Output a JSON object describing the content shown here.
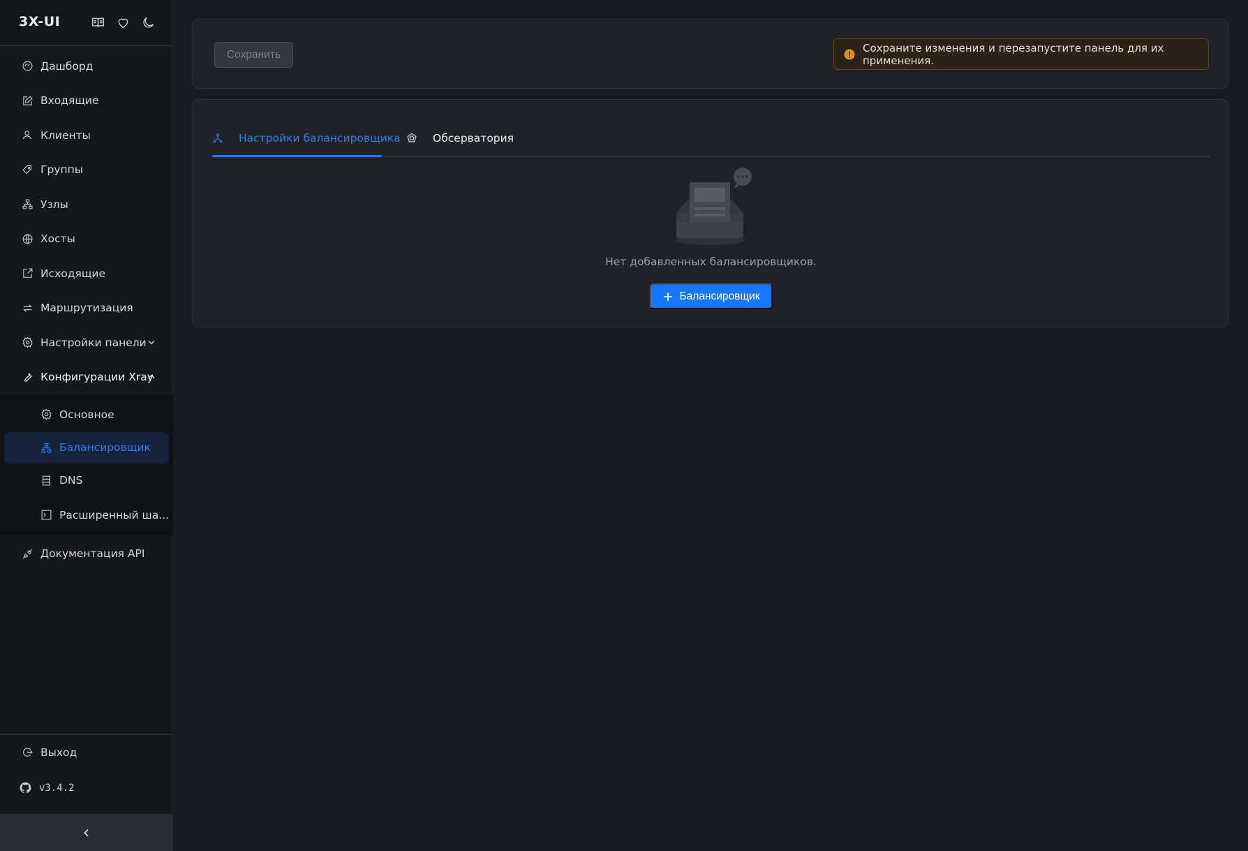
{
  "brand": {
    "title": "3X-UI"
  },
  "nav": {
    "items": [
      {
        "label": "Дашборд"
      },
      {
        "label": "Входящие"
      },
      {
        "label": "Клиенты"
      },
      {
        "label": "Группы"
      },
      {
        "label": "Узлы"
      },
      {
        "label": "Хосты"
      },
      {
        "label": "Исходящие"
      },
      {
        "label": "Маршрутизация"
      },
      {
        "label": "Настройки панели"
      },
      {
        "label": "Конфигурации Xray"
      }
    ],
    "xray_sub": [
      {
        "label": "Основное"
      },
      {
        "label": "Балансировщик"
      },
      {
        "label": "DNS"
      },
      {
        "label": "Расширенный ша..."
      }
    ],
    "api_docs": {
      "label": "Документация API"
    },
    "logout": {
      "label": "Выход"
    },
    "version": "v3.4.2"
  },
  "toolbar": {
    "save_label": "Сохранить",
    "alert_text": "Сохраните изменения и перезапустите панель для их применения."
  },
  "tabs": [
    {
      "label": "Настройки балансировщика"
    },
    {
      "label": "Обсерватория"
    }
  ],
  "empty": {
    "text": "Нет добавленных балансировщиков.",
    "add_label": "Балансировщик"
  },
  "colors": {
    "accent": "#1677ff",
    "sidebar_bg": "#16171b",
    "main_bg": "#1a1b20",
    "card_bg": "#212227",
    "warning": "#d89614"
  }
}
